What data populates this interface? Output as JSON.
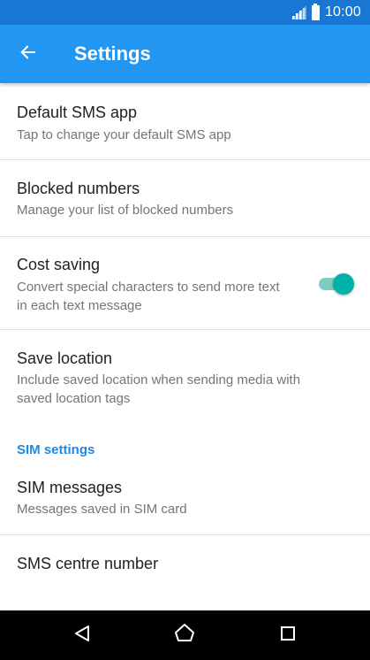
{
  "status_bar": {
    "time": "10:00",
    "icons": [
      "signal-icon",
      "battery-icon"
    ]
  },
  "app_bar": {
    "title": "Settings",
    "back_icon": "arrow-left-icon",
    "background_color": "#2196f3"
  },
  "settings": [
    {
      "title": "Default SMS app",
      "summary": "Tap to change your default SMS app"
    },
    {
      "title": "Blocked numbers",
      "summary": "Manage your list of blocked numbers"
    },
    {
      "title": "Cost saving",
      "summary": "Convert special characters to send more text in each text message",
      "toggle": true,
      "toggle_on": true
    },
    {
      "title": "Save location",
      "summary": "Include saved location when sending media with saved location tags"
    }
  ],
  "sim_section": {
    "header": "SIM settings",
    "items": [
      {
        "title": "SIM messages",
        "summary": "Messages saved in SIM card"
      },
      {
        "title": "SMS centre number"
      }
    ]
  },
  "nav_bar": {
    "icons": [
      "back-triangle-icon",
      "home-circle-icon",
      "recents-square-icon"
    ]
  },
  "colors": {
    "accent": "#00b2a9",
    "section_header": "#1e88e5",
    "status_bar": "#1976d2"
  }
}
